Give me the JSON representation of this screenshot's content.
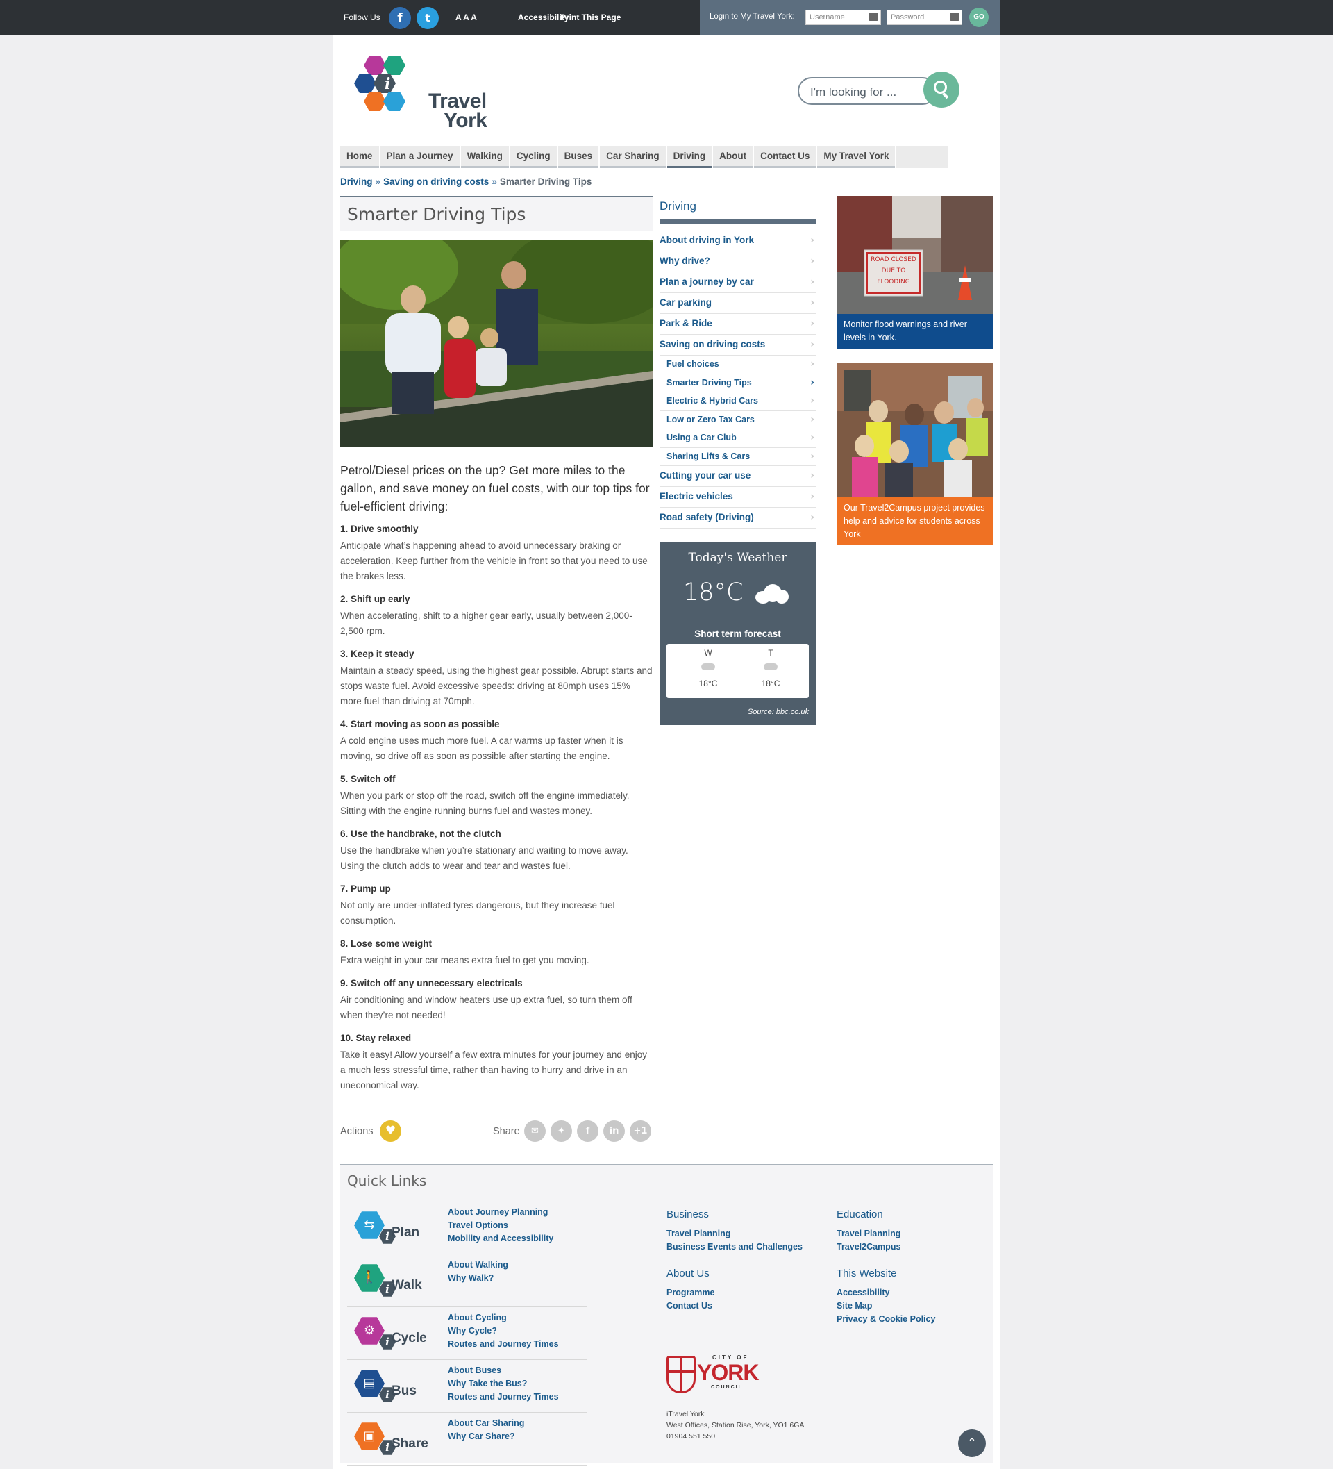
{
  "topbar": {
    "follow_us": "Follow Us",
    "facebook": "f",
    "twitter": "t",
    "text_size": "A A A",
    "accessibility": "Accessibility",
    "print": "Print This Page",
    "login_label": "Login to My Travel York:",
    "username_placeholder": "Username",
    "password_placeholder": "Password",
    "go": "GO"
  },
  "logo": {
    "line1": "Travel",
    "line2": "York",
    "badge": "i"
  },
  "search": {
    "placeholder": "I'm looking for ..."
  },
  "nav": [
    {
      "label": "Home"
    },
    {
      "label": "Plan a Journey"
    },
    {
      "label": "Walking"
    },
    {
      "label": "Cycling"
    },
    {
      "label": "Buses"
    },
    {
      "label": "Car Sharing"
    },
    {
      "label": "Driving",
      "active": true
    },
    {
      "label": "About"
    },
    {
      "label": "Contact Us"
    },
    {
      "label": "My Travel York"
    }
  ],
  "breadcrumb": {
    "level1": "Driving",
    "level2": "Saving on driving costs",
    "current": "Smarter Driving Tips",
    "sep": "»"
  },
  "main": {
    "title": "Smarter Driving Tips",
    "intro": "Petrol/Diesel prices on the up? Get more miles to the gallon, and save money on fuel costs, with our top tips for fuel-efficient driving:",
    "tips": [
      {
        "heading": "1. Drive smoothly",
        "text": "Anticipate what’s happening ahead to avoid unnecessary braking or acceleration. Keep further from the vehicle in front so that you need to use the brakes less."
      },
      {
        "heading": "2. Shift up early",
        "text": "When accelerating, shift to a higher gear early, usually between 2,000-2,500 rpm."
      },
      {
        "heading": "3. Keep it steady",
        "text": "Maintain a steady speed, using the highest gear possible. Abrupt starts and stops waste fuel. Avoid excessive speeds: driving at 80mph uses 15% more fuel than driving at 70mph."
      },
      {
        "heading": "4. Start moving as soon as possible",
        "text": "A cold engine uses much more fuel. A car warms up faster when it is moving, so drive off as soon as possible after starting the engine."
      },
      {
        "heading": "5. Switch off",
        "text": "When you park or stop off the road, switch off the engine immediately. Sitting with the engine running burns fuel and wastes money."
      },
      {
        "heading": "6. Use the handbrake, not the clutch",
        "text": "Use the handbrake when you’re stationary and waiting to move away. Using the clutch adds to wear and tear and wastes fuel."
      },
      {
        "heading": "7. Pump up",
        "text": "Not only are under-inflated tyres dangerous, but they increase fuel consumption."
      },
      {
        "heading": "8. Lose some weight",
        "text": "Extra weight in your car means extra fuel to get you moving."
      },
      {
        "heading": "9. Switch off any unnecessary electricals",
        "text": "Air conditioning and window heaters use up extra fuel, so turn them off when they’re not needed!"
      },
      {
        "heading": "10. Stay relaxed",
        "text": "Take it easy! Allow yourself a few extra minutes for your journey and enjoy a much less stressful time, rather than having to hurry and drive in an uneconomical way."
      }
    ],
    "actions_label": "Actions",
    "share_label": "Share",
    "plus_one": "+1",
    "share_linkedin": "in",
    "share_facebook": "f"
  },
  "sidebar": {
    "heading": "Driving",
    "items": [
      {
        "label": "About driving in York"
      },
      {
        "label": "Why drive?"
      },
      {
        "label": "Plan a journey by car"
      },
      {
        "label": "Car parking"
      },
      {
        "label": "Park & Ride"
      },
      {
        "label": "Saving on driving costs"
      },
      {
        "label": "Fuel choices",
        "sub": true
      },
      {
        "label": "Smarter Driving Tips",
        "sub": true,
        "current": true
      },
      {
        "label": "Electric & Hybrid Cars",
        "sub": true
      },
      {
        "label": "Low or Zero Tax Cars",
        "sub": true
      },
      {
        "label": "Using a Car Club",
        "sub": true
      },
      {
        "label": "Sharing Lifts & Cars",
        "sub": true
      },
      {
        "label": "Cutting your car use"
      },
      {
        "label": "Electric vehicles"
      },
      {
        "label": "Road safety (Driving)"
      }
    ]
  },
  "weather": {
    "title": "Today's Weather",
    "temp": "18°C",
    "short_term": "Short term forecast",
    "forecast": [
      {
        "day": "W",
        "temp": "18°C"
      },
      {
        "day": "T",
        "temp": "18°C"
      }
    ],
    "source": "Source: bbc.co.uk"
  },
  "promos": [
    {
      "caption": "Monitor flood warnings and river levels in York.",
      "sign_text": "ROAD CLOSED DUE TO FLOODING",
      "color": "#0f4c8d"
    },
    {
      "caption": "Our Travel2Campus project provides help and advice for students across York",
      "color": "#ef7123"
    }
  ],
  "quick_links": {
    "title": "Quick Links",
    "groups": [
      {
        "word": "Plan",
        "color": "#2aa1d8",
        "links": [
          "About Journey Planning",
          "Travel Options",
          "Mobility and Accessibility"
        ]
      },
      {
        "word": "Walk",
        "color": "#1fa37f",
        "links": [
          "About Walking",
          "Why Walk?"
        ]
      },
      {
        "word": "Cycle",
        "color": "#b7389a",
        "links": [
          "About Cycling",
          "Why Cycle?",
          "Routes and Journey Times"
        ]
      },
      {
        "word": "Bus",
        "color": "#1f4f91",
        "links": [
          "About Buses",
          "Why Take the Bus?",
          "Routes and Journey Times"
        ]
      },
      {
        "word": "Share",
        "color": "#ef7123",
        "links": [
          "About Car Sharing",
          "Why Car Share?"
        ]
      }
    ],
    "columns": [
      {
        "heading": "Business",
        "links": [
          "Travel Planning",
          "Business Events and Challenges"
        ]
      },
      {
        "heading": "Education",
        "links": [
          "Travel Planning",
          "Travel2Campus"
        ]
      },
      {
        "heading": "About Us",
        "links": [
          "Programme",
          "Contact Us"
        ]
      },
      {
        "heading": "This Website",
        "links": [
          "Accessibility",
          "Site Map",
          "Privacy & Cookie Policy"
        ]
      }
    ],
    "council": {
      "city_of": "CITY OF",
      "name": "YORK",
      "council": "COUNCIL"
    },
    "address": [
      "iTravel York",
      "West Offices, Station Rise, York, YO1 6GA",
      "01904 551 550"
    ]
  }
}
